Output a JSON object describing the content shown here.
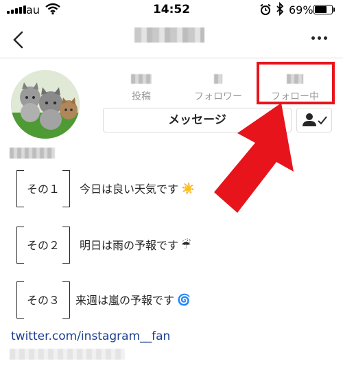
{
  "status_bar": {
    "carrier": "au",
    "time": "14:52",
    "battery_percent": "69%",
    "battery_level": 0.69
  },
  "profile": {
    "stats": {
      "posts_label": "投稿",
      "followers_label": "フォロワー",
      "following_label": "フォロー中"
    },
    "message_button": "メッセージ",
    "bio": [
      {
        "tag": "その１",
        "text": "今日は良い天気です",
        "emoji": "☀️"
      },
      {
        "tag": "その２",
        "text": "明日は雨の予報です",
        "emoji": "☔"
      },
      {
        "tag": "その３",
        "text": "来週は嵐の予報です",
        "emoji": "🌀"
      }
    ],
    "link": "twitter.com/instagram__fan"
  },
  "colors": {
    "highlight": "#e8141b",
    "link": "#1c3f8f"
  },
  "icons": [
    "signal-icon",
    "wifi-icon",
    "alarm-icon",
    "bluetooth-icon",
    "battery-icon",
    "back-icon",
    "more-icon",
    "person-check-icon"
  ]
}
